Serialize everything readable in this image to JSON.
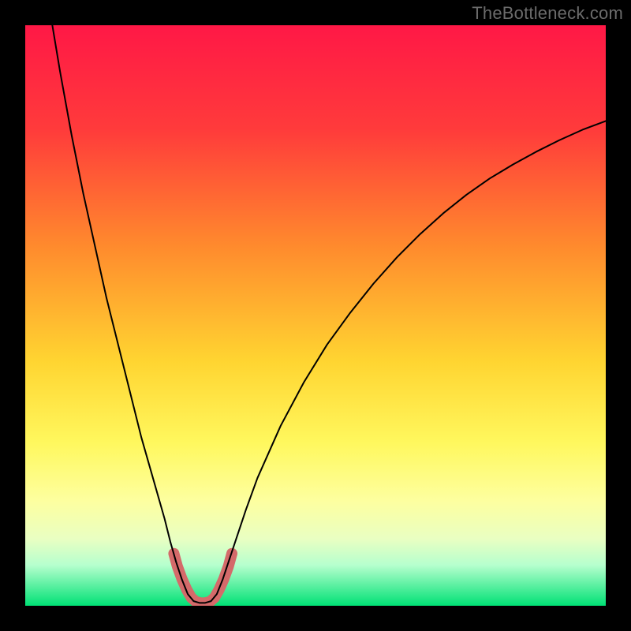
{
  "watermark": "TheBottleneck.com",
  "chart_data": {
    "type": "line",
    "title": "",
    "xlabel": "",
    "ylabel": "",
    "xlim": [
      0,
      100
    ],
    "ylim": [
      0,
      100
    ],
    "grid": false,
    "legend": false,
    "gradient_stops": [
      {
        "offset": 0.0,
        "color": "#ff1846"
      },
      {
        "offset": 0.18,
        "color": "#ff3b3b"
      },
      {
        "offset": 0.38,
        "color": "#ff8a2d"
      },
      {
        "offset": 0.58,
        "color": "#ffd531"
      },
      {
        "offset": 0.72,
        "color": "#fff85e"
      },
      {
        "offset": 0.82,
        "color": "#fdffa0"
      },
      {
        "offset": 0.885,
        "color": "#e9ffc2"
      },
      {
        "offset": 0.93,
        "color": "#b6ffce"
      },
      {
        "offset": 1.0,
        "color": "#00e175"
      }
    ],
    "series": [
      {
        "name": "curve",
        "stroke": "#000000",
        "stroke_width": 2,
        "points": [
          {
            "x": 4.0,
            "y": 104.0
          },
          {
            "x": 6.0,
            "y": 92.0
          },
          {
            "x": 8.0,
            "y": 81.0
          },
          {
            "x": 10.0,
            "y": 71.0
          },
          {
            "x": 12.0,
            "y": 62.0
          },
          {
            "x": 14.0,
            "y": 53.0
          },
          {
            "x": 16.0,
            "y": 45.0
          },
          {
            "x": 18.0,
            "y": 37.0
          },
          {
            "x": 20.0,
            "y": 29.0
          },
          {
            "x": 22.0,
            "y": 22.0
          },
          {
            "x": 24.0,
            "y": 15.0
          },
          {
            "x": 25.0,
            "y": 11.0
          },
          {
            "x": 26.0,
            "y": 7.5
          },
          {
            "x": 27.0,
            "y": 4.5
          },
          {
            "x": 28.0,
            "y": 2.0
          },
          {
            "x": 29.0,
            "y": 0.8
          },
          {
            "x": 30.0,
            "y": 0.5
          },
          {
            "x": 31.0,
            "y": 0.5
          },
          {
            "x": 32.0,
            "y": 0.8
          },
          {
            "x": 33.0,
            "y": 2.0
          },
          {
            "x": 34.0,
            "y": 4.5
          },
          {
            "x": 35.0,
            "y": 7.5
          },
          {
            "x": 36.0,
            "y": 10.5
          },
          {
            "x": 38.0,
            "y": 16.5
          },
          {
            "x": 40.0,
            "y": 22.0
          },
          {
            "x": 44.0,
            "y": 31.0
          },
          {
            "x": 48.0,
            "y": 38.5
          },
          {
            "x": 52.0,
            "y": 45.0
          },
          {
            "x": 56.0,
            "y": 50.5
          },
          {
            "x": 60.0,
            "y": 55.5
          },
          {
            "x": 64.0,
            "y": 60.0
          },
          {
            "x": 68.0,
            "y": 64.0
          },
          {
            "x": 72.0,
            "y": 67.6
          },
          {
            "x": 76.0,
            "y": 70.8
          },
          {
            "x": 80.0,
            "y": 73.6
          },
          {
            "x": 84.0,
            "y": 76.0
          },
          {
            "x": 88.0,
            "y": 78.2
          },
          {
            "x": 92.0,
            "y": 80.2
          },
          {
            "x": 96.0,
            "y": 82.0
          },
          {
            "x": 100.0,
            "y": 83.5
          }
        ]
      },
      {
        "name": "highlight",
        "stroke": "#d46a6a",
        "stroke_width": 14,
        "linecap": "round",
        "points": [
          {
            "x": 25.6,
            "y": 9.0
          },
          {
            "x": 26.2,
            "y": 6.8
          },
          {
            "x": 27.0,
            "y": 4.6
          },
          {
            "x": 27.8,
            "y": 2.8
          },
          {
            "x": 28.6,
            "y": 1.4
          },
          {
            "x": 29.4,
            "y": 0.7
          },
          {
            "x": 30.2,
            "y": 0.5
          },
          {
            "x": 31.0,
            "y": 0.5
          },
          {
            "x": 31.8,
            "y": 0.7
          },
          {
            "x": 32.6,
            "y": 1.4
          },
          {
            "x": 33.4,
            "y": 2.8
          },
          {
            "x": 34.2,
            "y": 4.6
          },
          {
            "x": 35.0,
            "y": 6.8
          },
          {
            "x": 35.6,
            "y": 9.0
          }
        ]
      }
    ]
  }
}
